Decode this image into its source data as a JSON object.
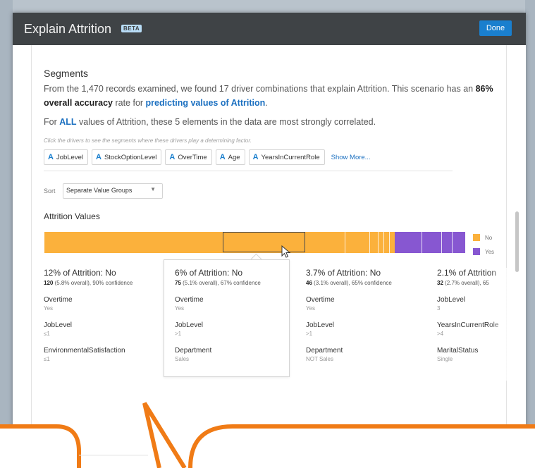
{
  "dialog": {
    "title": "Explain Attrition",
    "badge": "BETA",
    "done_label": "Done"
  },
  "segments_section": {
    "title": "Segments",
    "summary_part1": "From the 1,470 records examined, we found 17 driver combinations that explain Attrition. This scenario has an ",
    "accuracy": "86% overall accuracy",
    "summary_part2": " rate for ",
    "predict_link": "predicting values of Attrition",
    "summary_end": ".",
    "for_text": "For ",
    "all_link": "ALL",
    "for_text2": " values of Attrition, these 5 elements in the data are most strongly correlated.",
    "hint": "Click the drivers to see the segments where these drivers play a determining factor.",
    "drivers": [
      "JobLevel",
      "StockOptionLevel",
      "OverTime",
      "Age",
      "YearsInCurrentRole"
    ],
    "show_more": "Show More..."
  },
  "sort": {
    "label": "Sort",
    "value": "Separate Value Groups"
  },
  "attrition_values": {
    "title": "Attrition Values",
    "legend": [
      {
        "label": "No",
        "color": "#fbb13c"
      },
      {
        "label": "Yes",
        "color": "#8757d1"
      }
    ]
  },
  "segment_cards": [
    {
      "heading": "12% of Attrition: No",
      "count": "120",
      "stats": " (5.8% overall), 90% confidence",
      "drivers": [
        {
          "name": "Overtime",
          "value": "Yes"
        },
        {
          "name": "JobLevel",
          "value": "≤1"
        },
        {
          "name": "EnvironmentalSatisfaction",
          "value": "≤1"
        }
      ]
    },
    {
      "heading": "6% of Attrition: No",
      "count": "75",
      "stats": " (5.1% overall), 67% confidence",
      "drivers": [
        {
          "name": "Overtime",
          "value": "Yes"
        },
        {
          "name": "JobLevel",
          "value": ">1"
        },
        {
          "name": "Department",
          "value": "Sales"
        }
      ]
    },
    {
      "heading": "3.7% of Attrition: No",
      "count": "46",
      "stats": " (3.1% overall), 65% confidence",
      "drivers": [
        {
          "name": "Overtime",
          "value": "Yes"
        },
        {
          "name": "JobLevel",
          "value": ">1"
        },
        {
          "name": "Department",
          "value": "NOT Sales"
        }
      ]
    },
    {
      "heading": "2.1% of Attrition",
      "count": "32",
      "stats": " (2.7% overall), 65",
      "drivers": [
        {
          "name": "JobLevel",
          "value": "3"
        },
        {
          "name": "YearsInCurrentRole",
          "value": ">4"
        },
        {
          "name": "MaritalStatus",
          "value": "Single"
        }
      ]
    }
  ]
}
